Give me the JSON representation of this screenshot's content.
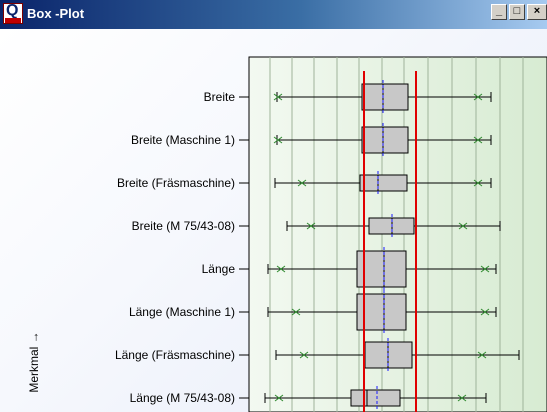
{
  "window": {
    "title": "Box -Plot",
    "app_icon_letter": "Q",
    "minimize_glyph": "_",
    "maximize_glyph": "□",
    "close_glyph": "×"
  },
  "y_axis_title": "Merkmal →",
  "colors": {
    "box_fill": "#c8c8c8",
    "spec_line": "#e00000",
    "mean_line": "#1a1aff",
    "outlier_mark": "#2f8a2f",
    "plot_bg": "#e6f2e2"
  },
  "rows": [
    {
      "label": "Breite"
    },
    {
      "label": "Breite (Maschine 1)"
    },
    {
      "label": "Breite (Fräsmaschine)"
    },
    {
      "label": "Breite (M 75/43-08)"
    },
    {
      "label": "Länge"
    },
    {
      "label": "Länge (Maschine 1)"
    },
    {
      "label": "Länge (Fräsmaschine)"
    },
    {
      "label": "Länge (M 75/43-08)"
    }
  ]
}
